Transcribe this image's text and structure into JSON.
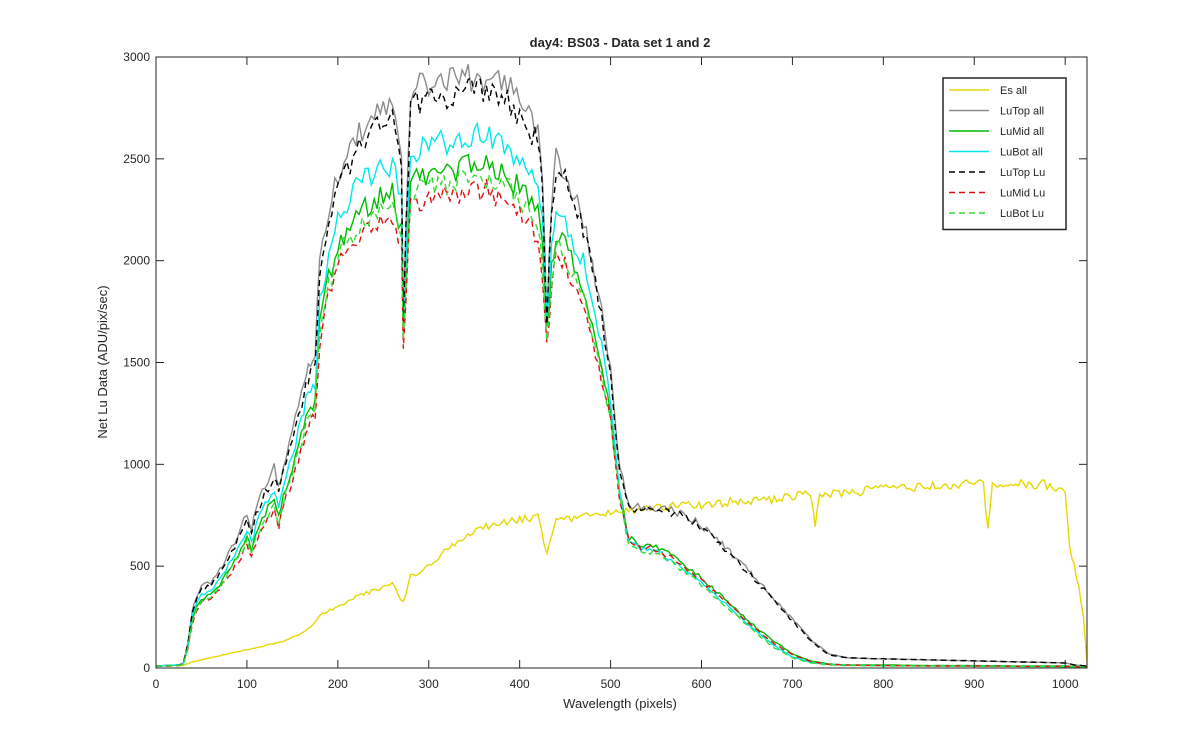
{
  "chart_data": {
    "type": "line",
    "title": "day4: BS03 - Data set 1 and 2",
    "xlabel": "Wavelength (pixels)",
    "ylabel": "Net Lu Data (ADU/pix/sec)",
    "xlim": [
      0,
      1024
    ],
    "ylim": [
      0,
      3000
    ],
    "xticks": [
      0,
      100,
      200,
      300,
      400,
      500,
      600,
      700,
      800,
      900,
      1000
    ],
    "yticks": [
      0,
      500,
      1000,
      1500,
      2000,
      2500,
      3000
    ],
    "grid": false,
    "legend_position": "top-right",
    "series": [
      {
        "name": "Es  all",
        "color": "#e6d800",
        "dash": "solid",
        "x": [
          0,
          30,
          40,
          60,
          80,
          100,
          120,
          140,
          160,
          170,
          180,
          200,
          220,
          240,
          260,
          272,
          280,
          300,
          320,
          340,
          360,
          380,
          400,
          420,
          430,
          440,
          460,
          480,
          500,
          520,
          540,
          560,
          580,
          600,
          620,
          640,
          660,
          680,
          700,
          720,
          725,
          730,
          760,
          780,
          800,
          820,
          840,
          860,
          880,
          900,
          910,
          915,
          920,
          940,
          960,
          980,
          990,
          1000,
          1005,
          1010,
          1015,
          1020,
          1024
        ],
        "y": [
          10,
          12,
          30,
          50,
          70,
          90,
          110,
          130,
          170,
          200,
          260,
          300,
          350,
          380,
          410,
          320,
          450,
          500,
          580,
          650,
          690,
          710,
          730,
          740,
          560,
          720,
          740,
          750,
          760,
          770,
          780,
          790,
          800,
          800,
          810,
          820,
          820,
          830,
          840,
          860,
          710,
          850,
          860,
          870,
          880,
          885,
          890,
          895,
          900,
          905,
          910,
          680,
          890,
          900,
          905,
          900,
          880,
          850,
          600,
          500,
          400,
          250,
          30
        ]
      },
      {
        "name": "LuTop  all",
        "color": "#8c8c8c",
        "dash": "solid",
        "x": [
          0,
          25,
          30,
          35,
          40,
          45,
          50,
          60,
          70,
          80,
          90,
          100,
          105,
          110,
          120,
          130,
          135,
          140,
          150,
          160,
          165,
          170,
          175,
          180,
          190,
          200,
          210,
          220,
          230,
          240,
          250,
          260,
          270,
          272,
          275,
          280,
          290,
          300,
          310,
          320,
          330,
          340,
          350,
          360,
          370,
          380,
          390,
          400,
          410,
          420,
          425,
          430,
          435,
          440,
          450,
          460,
          470,
          480,
          490,
          500,
          510,
          520,
          530,
          540,
          550,
          560,
          570,
          580,
          590,
          600,
          620,
          640,
          660,
          680,
          700,
          720,
          740,
          760,
          800,
          850,
          900,
          950,
          1000,
          1010,
          1024
        ],
        "y": [
          10,
          15,
          25,
          120,
          280,
          350,
          400,
          420,
          480,
          560,
          650,
          760,
          680,
          780,
          900,
          980,
          880,
          1000,
          1150,
          1350,
          1450,
          1500,
          1550,
          2000,
          2250,
          2420,
          2520,
          2600,
          2650,
          2700,
          2720,
          2740,
          2500,
          1700,
          2200,
          2800,
          2850,
          2850,
          2880,
          2870,
          2880,
          2900,
          2900,
          2900,
          2880,
          2860,
          2830,
          2760,
          2700,
          2650,
          2400,
          1700,
          2300,
          2500,
          2450,
          2300,
          2200,
          2000,
          1750,
          1450,
          1000,
          800,
          790,
          790,
          780,
          780,
          770,
          750,
          730,
          700,
          620,
          530,
          440,
          340,
          240,
          140,
          70,
          50,
          45,
          40,
          35,
          30,
          25,
          15,
          10
        ]
      },
      {
        "name": "LuMid  all",
        "color": "#00bb00",
        "dash": "solid",
        "x": [
          0,
          25,
          30,
          35,
          40,
          45,
          50,
          60,
          70,
          80,
          90,
          100,
          105,
          110,
          120,
          130,
          135,
          140,
          150,
          160,
          165,
          170,
          175,
          180,
          190,
          200,
          210,
          220,
          230,
          240,
          250,
          260,
          270,
          272,
          275,
          280,
          290,
          300,
          310,
          320,
          330,
          340,
          350,
          360,
          370,
          380,
          390,
          400,
          410,
          420,
          425,
          430,
          435,
          440,
          450,
          460,
          470,
          480,
          490,
          500,
          510,
          520,
          530,
          540,
          550,
          560,
          570,
          580,
          590,
          600,
          620,
          640,
          660,
          680,
          700,
          720,
          740,
          760,
          800,
          850,
          900,
          950,
          1000,
          1010,
          1024
        ],
        "y": [
          10,
          15,
          20,
          100,
          240,
          300,
          340,
          360,
          410,
          480,
          550,
          640,
          580,
          660,
          760,
          830,
          740,
          850,
          980,
          1150,
          1230,
          1270,
          1310,
          1700,
          1920,
          2070,
          2150,
          2220,
          2260,
          2300,
          2320,
          2340,
          2150,
          1650,
          1900,
          2380,
          2420,
          2420,
          2450,
          2440,
          2450,
          2470,
          2470,
          2470,
          2450,
          2430,
          2400,
          2350,
          2300,
          2250,
          2050,
          1650,
          1950,
          2130,
          2080,
          1960,
          1880,
          1700,
          1500,
          1250,
          850,
          640,
          610,
          600,
          590,
          570,
          540,
          510,
          480,
          440,
          360,
          280,
          200,
          130,
          70,
          35,
          20,
          15,
          15,
          12,
          12,
          10,
          10,
          8,
          5
        ]
      },
      {
        "name": "LuBot  all",
        "color": "#00e8ee",
        "dash": "solid",
        "x": [
          0,
          25,
          30,
          35,
          40,
          45,
          50,
          60,
          70,
          80,
          90,
          100,
          105,
          110,
          120,
          130,
          135,
          140,
          150,
          160,
          165,
          170,
          175,
          180,
          190,
          200,
          210,
          220,
          230,
          240,
          250,
          260,
          270,
          272,
          275,
          280,
          290,
          300,
          310,
          320,
          330,
          340,
          350,
          360,
          370,
          380,
          390,
          400,
          410,
          420,
          425,
          430,
          435,
          440,
          450,
          460,
          470,
          480,
          490,
          500,
          510,
          520,
          530,
          540,
          550,
          560,
          570,
          580,
          590,
          600,
          620,
          640,
          660,
          680,
          700,
          720,
          740,
          760,
          800,
          850,
          900,
          950,
          1000,
          1010,
          1024
        ],
        "y": [
          10,
          15,
          20,
          110,
          260,
          320,
          360,
          380,
          440,
          510,
          590,
          680,
          610,
          700,
          810,
          880,
          790,
          900,
          1040,
          1220,
          1310,
          1350,
          1390,
          1800,
          2030,
          2190,
          2280,
          2350,
          2400,
          2440,
          2460,
          2480,
          2280,
          1700,
          2000,
          2520,
          2560,
          2560,
          2590,
          2580,
          2590,
          2610,
          2610,
          2610,
          2590,
          2570,
          2540,
          2490,
          2430,
          2380,
          2170,
          1700,
          2060,
          2250,
          2200,
          2080,
          1990,
          1800,
          1580,
          1300,
          860,
          630,
          590,
          580,
          570,
          550,
          520,
          490,
          460,
          420,
          340,
          260,
          180,
          110,
          55,
          28,
          18,
          14,
          12,
          10,
          10,
          8,
          8,
          6,
          4
        ]
      },
      {
        "name": "LuTop  Lu",
        "color": "#000000",
        "dash": "dashed",
        "x": [
          0,
          25,
          30,
          35,
          40,
          45,
          50,
          60,
          70,
          80,
          90,
          100,
          105,
          110,
          120,
          130,
          135,
          140,
          150,
          160,
          165,
          170,
          175,
          180,
          190,
          200,
          210,
          220,
          230,
          240,
          250,
          260,
          270,
          272,
          275,
          280,
          290,
          300,
          310,
          320,
          330,
          340,
          350,
          360,
          370,
          380,
          390,
          400,
          410,
          420,
          425,
          430,
          435,
          440,
          450,
          460,
          470,
          480,
          490,
          500,
          510,
          520,
          530,
          540,
          550,
          560,
          570,
          580,
          590,
          600,
          620,
          640,
          660,
          680,
          700,
          720,
          740,
          760,
          800,
          850,
          900,
          950,
          1000,
          1010,
          1024
        ],
        "y": [
          8,
          12,
          22,
          115,
          270,
          340,
          385,
          405,
          460,
          540,
          630,
          730,
          650,
          750,
          860,
          940,
          850,
          960,
          1110,
          1300,
          1400,
          1450,
          1500,
          1950,
          2200,
          2370,
          2460,
          2540,
          2590,
          2640,
          2660,
          2680,
          2450,
          1680,
          2150,
          2740,
          2790,
          2790,
          2820,
          2810,
          2820,
          2840,
          2840,
          2840,
          2820,
          2800,
          2770,
          2700,
          2650,
          2600,
          2350,
          1680,
          2250,
          2450,
          2400,
          2260,
          2160,
          1960,
          1720,
          1420,
          980,
          790,
          780,
          780,
          770,
          770,
          760,
          740,
          720,
          690,
          610,
          520,
          430,
          330,
          230,
          135,
          65,
          50,
          45,
          40,
          35,
          30,
          25,
          15,
          10
        ]
      },
      {
        "name": "LuMid  Lu",
        "color": "#e01010",
        "dash": "dashed",
        "x": [
          0,
          25,
          30,
          35,
          40,
          45,
          50,
          60,
          70,
          80,
          90,
          100,
          105,
          110,
          120,
          130,
          135,
          140,
          150,
          160,
          165,
          170,
          175,
          180,
          190,
          200,
          210,
          220,
          230,
          240,
          250,
          260,
          270,
          272,
          275,
          280,
          290,
          300,
          310,
          320,
          330,
          340,
          350,
          360,
          370,
          380,
          390,
          400,
          410,
          420,
          425,
          430,
          435,
          440,
          450,
          460,
          470,
          480,
          490,
          500,
          510,
          520,
          530,
          540,
          550,
          560,
          570,
          580,
          590,
          600,
          620,
          640,
          660,
          680,
          700,
          720,
          740,
          760,
          800,
          850,
          900,
          950,
          1000,
          1010,
          1024
        ],
        "y": [
          8,
          12,
          18,
          95,
          220,
          280,
          320,
          340,
          390,
          450,
          520,
          600,
          540,
          620,
          710,
          780,
          690,
          800,
          920,
          1080,
          1160,
          1200,
          1240,
          1610,
          1820,
          1960,
          2040,
          2100,
          2140,
          2180,
          2200,
          2220,
          2040,
          1600,
          1800,
          2260,
          2300,
          2300,
          2330,
          2320,
          2330,
          2350,
          2350,
          2350,
          2330,
          2310,
          2280,
          2230,
          2180,
          2130,
          1950,
          1580,
          1850,
          2030,
          1980,
          1870,
          1790,
          1620,
          1430,
          1200,
          820,
          620,
          600,
          590,
          580,
          560,
          530,
          500,
          470,
          430,
          350,
          270,
          190,
          120,
          65,
          32,
          18,
          14,
          12,
          10,
          10,
          8,
          8,
          6,
          4
        ]
      },
      {
        "name": "LuBot  Lu",
        "color": "#33dd33",
        "dash": "dashed",
        "x": [
          0,
          25,
          30,
          35,
          40,
          45,
          50,
          60,
          70,
          80,
          90,
          100,
          105,
          110,
          120,
          130,
          135,
          140,
          150,
          160,
          165,
          170,
          175,
          180,
          190,
          200,
          210,
          220,
          230,
          240,
          250,
          260,
          270,
          272,
          275,
          280,
          290,
          300,
          310,
          320,
          330,
          340,
          350,
          360,
          370,
          380,
          390,
          400,
          410,
          420,
          425,
          430,
          435,
          440,
          450,
          460,
          470,
          480,
          490,
          500,
          510,
          520,
          530,
          540,
          550,
          560,
          570,
          580,
          590,
          600,
          620,
          640,
          660,
          680,
          700,
          720,
          740,
          760,
          800,
          850,
          900,
          950,
          1000,
          1010,
          1024
        ],
        "y": [
          8,
          12,
          18,
          100,
          230,
          290,
          330,
          350,
          400,
          470,
          540,
          620,
          560,
          640,
          730,
          800,
          710,
          820,
          950,
          1110,
          1190,
          1230,
          1270,
          1650,
          1870,
          2010,
          2090,
          2160,
          2200,
          2240,
          2260,
          2280,
          2090,
          1620,
          1850,
          2320,
          2360,
          2360,
          2390,
          2380,
          2390,
          2410,
          2410,
          2410,
          2390,
          2370,
          2340,
          2290,
          2240,
          2190,
          2000,
          1600,
          1900,
          2080,
          2030,
          1910,
          1830,
          1650,
          1460,
          1220,
          830,
          610,
          580,
          570,
          560,
          540,
          510,
          480,
          450,
          410,
          330,
          250,
          170,
          100,
          50,
          25,
          15,
          12,
          10,
          10,
          8,
          8,
          6,
          5,
          4
        ]
      }
    ]
  }
}
